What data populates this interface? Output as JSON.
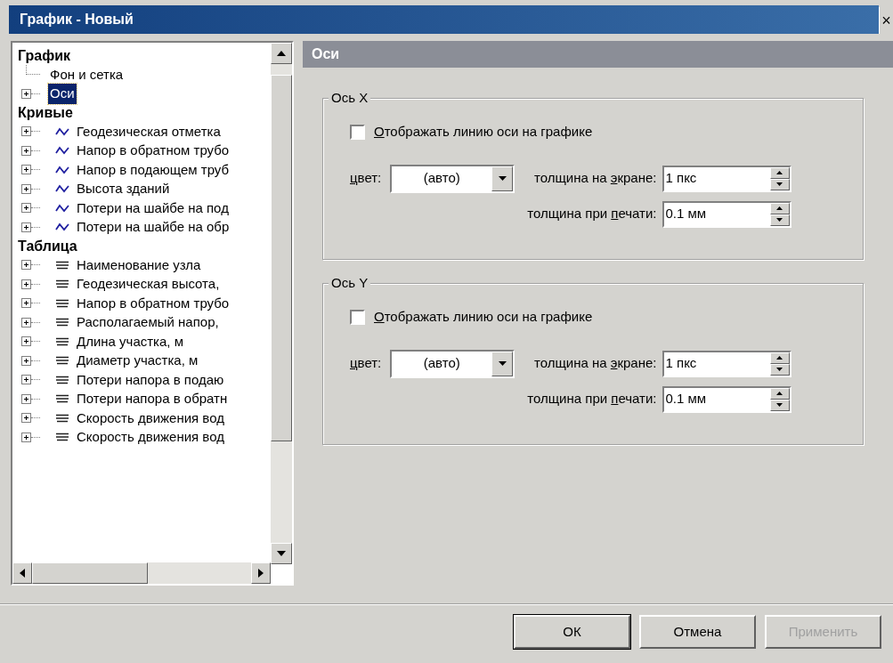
{
  "window": {
    "title": "График - Новый",
    "close": "×"
  },
  "tree": {
    "sections": [
      {
        "title": "График",
        "items": [
          {
            "label": "Фон и сетка",
            "kind": "plain",
            "expandable": false,
            "selected": false
          },
          {
            "label": "Оси",
            "kind": "plain",
            "expandable": true,
            "selected": true
          }
        ]
      },
      {
        "title": "Кривые",
        "items": [
          {
            "label": "Геодезическая отметка",
            "kind": "curve",
            "expandable": true,
            "selected": false
          },
          {
            "label": "Напор в обратном трубо",
            "kind": "curve",
            "expandable": true,
            "selected": false
          },
          {
            "label": "Напор в подающем труб",
            "kind": "curve",
            "expandable": true,
            "selected": false
          },
          {
            "label": "Высота зданий",
            "kind": "curve",
            "expandable": true,
            "selected": false
          },
          {
            "label": "Потери на шайбе на под",
            "kind": "curve",
            "expandable": true,
            "selected": false
          },
          {
            "label": "Потери на шайбе на обр",
            "kind": "curve",
            "expandable": true,
            "selected": false
          }
        ]
      },
      {
        "title": "Таблица",
        "items": [
          {
            "label": "Наименование узла",
            "kind": "column",
            "expandable": true,
            "selected": false
          },
          {
            "label": "Геодезическая высота,",
            "kind": "column",
            "expandable": true,
            "selected": false
          },
          {
            "label": "Напор в обратном трубо",
            "kind": "column",
            "expandable": true,
            "selected": false
          },
          {
            "label": "Располагаемый напор,",
            "kind": "column",
            "expandable": true,
            "selected": false
          },
          {
            "label": "Длина участка, м",
            "kind": "column",
            "expandable": true,
            "selected": false
          },
          {
            "label": "Диаметр участка, м",
            "kind": "column",
            "expandable": true,
            "selected": false
          },
          {
            "label": "Потери напора в подаю",
            "kind": "column",
            "expandable": true,
            "selected": false
          },
          {
            "label": "Потери напора в обратн",
            "kind": "column",
            "expandable": true,
            "selected": false
          },
          {
            "label": "Скорость движения вод",
            "kind": "column",
            "expandable": true,
            "selected": false
          },
          {
            "label": "Скорость движения вод",
            "kind": "column",
            "expandable": true,
            "selected": false
          }
        ]
      }
    ]
  },
  "panel": {
    "title": "Оси",
    "groups": [
      {
        "title": "Ось X",
        "show_axis": {
          "label": {
            "key": "О",
            "after": "тображать линию оси на графике"
          },
          "checked": false
        },
        "color": {
          "label": {
            "key": "ц",
            "after": "вет:"
          },
          "value": "(авто)"
        },
        "screen_width": {
          "label": {
            "before": "толщина на ",
            "key": "э",
            "after": "кране:"
          },
          "value": "1 пкс"
        },
        "print_width": {
          "label": {
            "before": "толщина при ",
            "key": "п",
            "after": "ечати:"
          },
          "value": "0.1 мм"
        }
      },
      {
        "title": "Ось Y",
        "show_axis": {
          "label": {
            "key": "О",
            "after": "тображать линию оси на графике"
          },
          "checked": false
        },
        "color": {
          "label": {
            "key": "ц",
            "after": "вет:"
          },
          "value": "(авто)"
        },
        "screen_width": {
          "label": {
            "before": "толщина на ",
            "key": "э",
            "after": "кране:"
          },
          "value": "1 пкс"
        },
        "print_width": {
          "label": {
            "before": "толщина при ",
            "key": "п",
            "after": "ечати:"
          },
          "value": "0.1 мм"
        }
      }
    ]
  },
  "buttons": [
    {
      "label": "ОК",
      "disabled": false
    },
    {
      "label": "Отмена",
      "disabled": false
    },
    {
      "label": "Применить",
      "disabled": true
    }
  ]
}
